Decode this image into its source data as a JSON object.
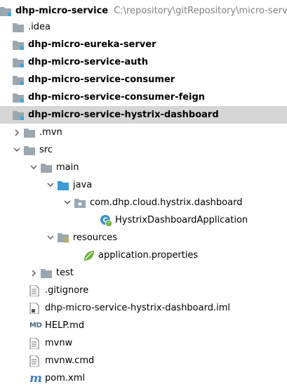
{
  "tree": {
    "root": {
      "label": "dhp-micro-service",
      "path": "C:\\repository\\gitRepository\\micro-service"
    },
    "idea": ".idea",
    "eureka": "dhp-micro-eureka-server",
    "auth": "dhp-micro-service-auth",
    "consumer": "dhp-micro-service-consumer",
    "consumer_feign": "dhp-micro-service-consumer-feign",
    "hystrix": "dhp-micro-service-hystrix-dashboard",
    "mvn": ".mvn",
    "src": "src",
    "main": "main",
    "java": "java",
    "package": "com.dhp.cloud.hystrix.dashboard",
    "app_class": "HystrixDashboardApplication",
    "resources": "resources",
    "app_props": "application.properties",
    "test": "test",
    "gitignore": ".gitignore",
    "iml": "dhp-micro-service-hystrix-dashboard.iml",
    "help": "HELP.md",
    "mvnw": "mvnw",
    "mvnw_cmd": "mvnw.cmd",
    "pom": "pom.xml",
    "md_badge": "MD",
    "m_badge": "m"
  },
  "colors": {
    "selection": "#d5d5d5",
    "folder": "#9aa7b0",
    "module_accent": "#40a6e0",
    "source_folder": "#3d9ad6",
    "resources_stripe": "#e0b030",
    "spring_green": "#6cb23a"
  }
}
